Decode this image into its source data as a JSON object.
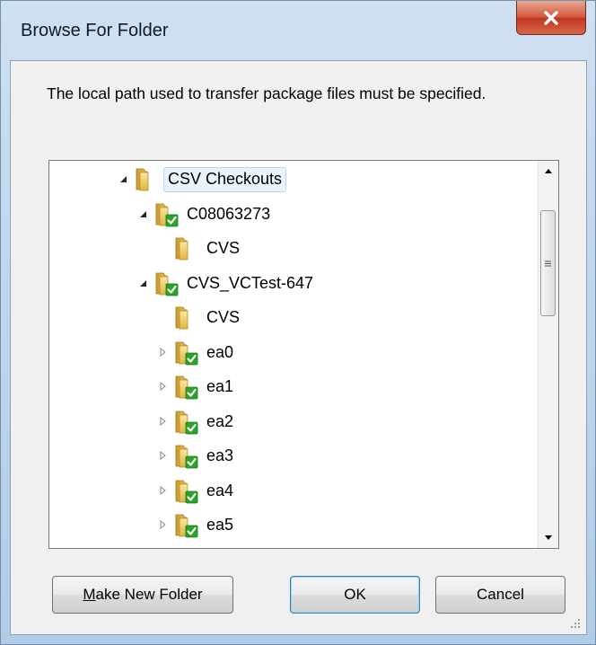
{
  "window": {
    "title": "Browse For Folder",
    "close_label": "X"
  },
  "dialog": {
    "description": "The local path used to transfer package files must be specified."
  },
  "tree": {
    "items": [
      {
        "label": "CSV Checkouts",
        "expander": "expanded",
        "icon": "folder-icon",
        "selected": true
      },
      {
        "label": "C08063273",
        "expander": "expanded",
        "icon": "folder-synced-icon",
        "selected": false
      },
      {
        "label": "CVS",
        "expander": "none",
        "icon": "folder-icon",
        "selected": false
      },
      {
        "label": "CVS_VCTest-647",
        "expander": "expanded",
        "icon": "folder-synced-icon",
        "selected": false
      },
      {
        "label": "CVS",
        "expander": "none",
        "icon": "folder-icon",
        "selected": false
      },
      {
        "label": "ea0",
        "expander": "collapsed",
        "icon": "folder-synced-icon",
        "selected": false
      },
      {
        "label": "ea1",
        "expander": "collapsed",
        "icon": "folder-synced-icon",
        "selected": false
      },
      {
        "label": "ea2",
        "expander": "collapsed",
        "icon": "folder-synced-icon",
        "selected": false
      },
      {
        "label": "ea3",
        "expander": "collapsed",
        "icon": "folder-synced-icon",
        "selected": false
      },
      {
        "label": "ea4",
        "expander": "collapsed",
        "icon": "folder-synced-icon",
        "selected": false
      },
      {
        "label": "ea5",
        "expander": "collapsed",
        "icon": "folder-synced-icon",
        "selected": false
      }
    ]
  },
  "buttons": {
    "make_new_folder_mnemonic": "M",
    "make_new_folder_rest": "ake New Folder",
    "ok": "OK",
    "cancel": "Cancel"
  },
  "colors": {
    "folder": "#e8c35a",
    "sync_check": "#2aa52a",
    "selection": "#ebf4fd"
  }
}
